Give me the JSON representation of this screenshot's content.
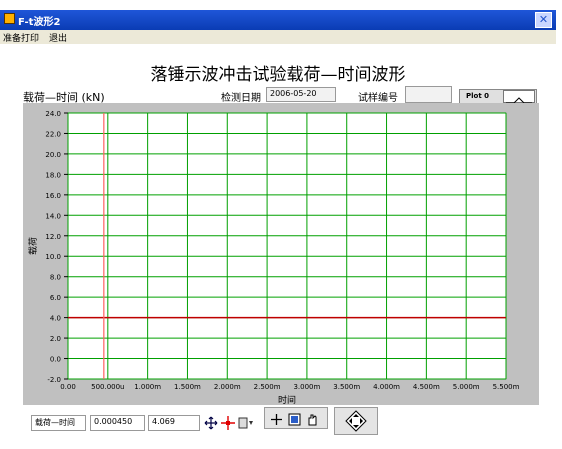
{
  "window": {
    "title": "F-t波形2",
    "close_glyph": "✕"
  },
  "menu": {
    "items": [
      "准备打印",
      "退出"
    ]
  },
  "panel": {
    "title": "落锤示波冲击试验载荷—时间波形",
    "chart_label": "载荷—时间 (kN)",
    "date_label": "检测日期",
    "date_value": "2006-05-20",
    "sample_label": "试样编号",
    "sample_value": "",
    "plot_legend": "Plot 0"
  },
  "cursor": {
    "name": "载荷—时间",
    "x_value": "0.000450",
    "y_value": "4.069"
  },
  "colors": {
    "grid": "#00a000",
    "plot_bg": "#ffffff",
    "series": "#c00000",
    "cursor": "#ff6060"
  },
  "chart_data": {
    "type": "line",
    "xlabel": "时间",
    "ylabel": "载荷",
    "xlim": [
      0,
      0.0055
    ],
    "ylim": [
      -2,
      24
    ],
    "x_ticks": [
      "0.00",
      "500.000u",
      "1.000m",
      "1.500m",
      "2.000m",
      "2.500m",
      "3.000m",
      "3.500m",
      "4.000m",
      "4.500m",
      "5.000m",
      "5.500m"
    ],
    "y_ticks": [
      "24.0",
      "22.0",
      "20.0",
      "18.0",
      "16.0",
      "14.0",
      "12.0",
      "10.0",
      "8.0",
      "6.0",
      "4.0",
      "2.0",
      "0.0",
      "-2.0"
    ],
    "grid": true,
    "series": [
      {
        "x": [
          0,
          0.0055
        ],
        "y": [
          4.0,
          4.0
        ]
      }
    ],
    "cursor_x": 0.00045
  }
}
